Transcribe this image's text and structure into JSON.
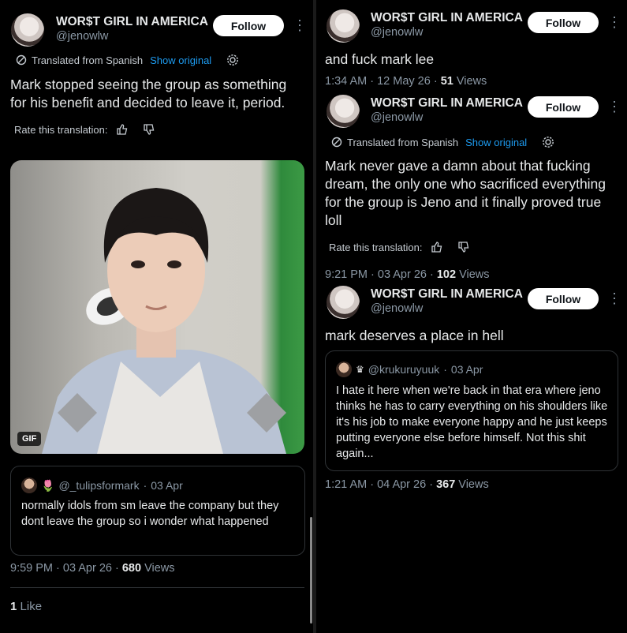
{
  "post_left": {
    "author": "WOR$T GIRL IN AMERICA",
    "handle": "@jenowlw",
    "follow_label": "Follow",
    "translated_label": "Translated from Spanish",
    "show_original": "Show original",
    "text": "Mark stopped seeing the group as something for his benefit and decided to leave it, period.",
    "rate_label": "Rate this translation:",
    "gif_tag": "GIF",
    "quote": {
      "handle": "@_tulipsformark",
      "date": "03 Apr",
      "text": "normally idols from sm leave the company but they dont leave the group so i wonder what happened"
    },
    "time": "9:59 PM",
    "date": "03 Apr 26",
    "views_count": "680",
    "views_label": "Views",
    "likes_count": "1",
    "likes_label": "Like"
  },
  "post_r1": {
    "author": "WOR$T GIRL IN AMERICA",
    "handle": "@jenowlw",
    "follow_label": "Follow",
    "text": "and fuck mark lee",
    "time": "1:34 AM",
    "date": "12 May 26",
    "views_count": "51",
    "views_label": "Views"
  },
  "post_r2": {
    "author": "WOR$T GIRL IN AMERICA",
    "handle": "@jenowlw",
    "follow_label": "Follow",
    "translated_label": "Translated from Spanish",
    "show_original": "Show original",
    "text": "Mark never gave a damn about that fucking dream, the only one who sacrificed everything for the group is Jeno and it finally proved true loll",
    "rate_label": "Rate this translation:",
    "time": "9:21 PM",
    "date": "03 Apr 26",
    "views_count": "102",
    "views_label": "Views"
  },
  "post_r3": {
    "author": "WOR$T GIRL IN AMERICA",
    "handle": "@jenowlw",
    "follow_label": "Follow",
    "text": "mark deserves a place in hell",
    "quote": {
      "handle": "@krukuruyuuk",
      "date": "03 Apr",
      "text": "I hate it here when we're back in that era where jeno thinks he has to carry everything on his shoulders like it's his job to make everyone happy and he just keeps putting everyone else before himself. Not this shit again..."
    },
    "time": "1:21 AM",
    "date": "04 Apr 26",
    "views_count": "367",
    "views_label": "Views"
  },
  "colors": {
    "link": "#1d9bf0",
    "muted": "#8b98a5",
    "text": "#e7e9ea",
    "background": "#000000"
  },
  "icons": [
    "translate-icon",
    "gear-icon",
    "thumbs-up-icon",
    "thumbs-down-icon",
    "more-icon",
    "crown-icon",
    "tulip-icon"
  ]
}
